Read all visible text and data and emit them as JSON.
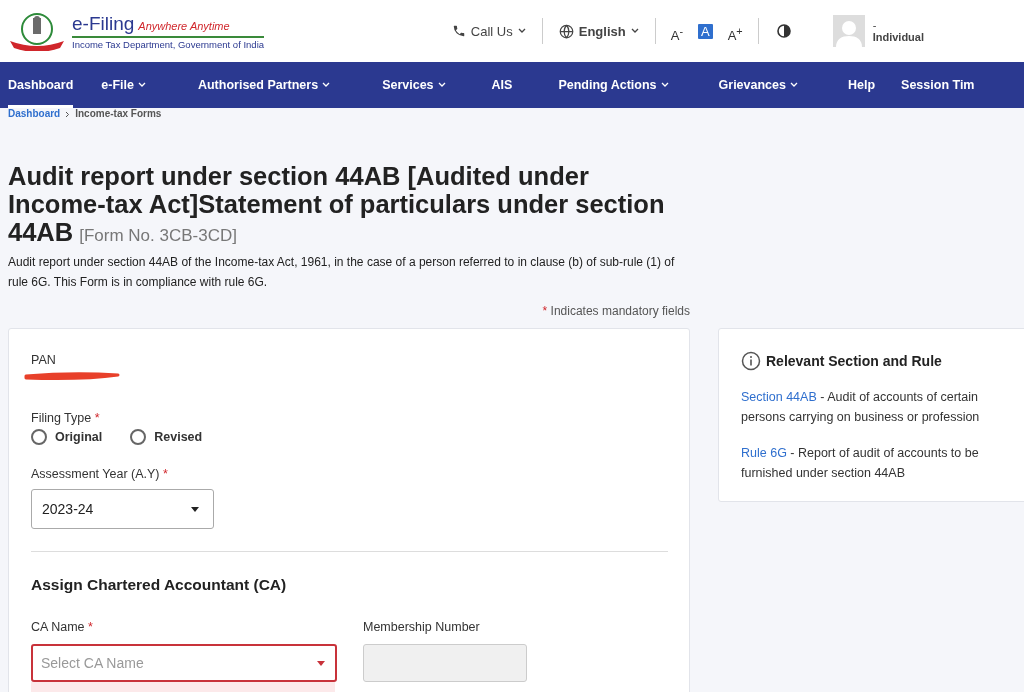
{
  "header": {
    "brand": "e-Filing",
    "tagline": "Anywhere Anytime",
    "department": "Income Tax Department, Government of India",
    "call_us": "Call Us",
    "language": "English",
    "font_sizes": [
      {
        "label": "A$^{-}$",
        "selected": false
      },
      {
        "label": "A",
        "selected": true
      },
      {
        "label": "A$^{+}$",
        "selected": false
      }
    ],
    "user": {
      "name": "-",
      "role": "Individual"
    }
  },
  "nav": [
    {
      "label": "Dashboard",
      "selected": true,
      "dropdown": false
    },
    {
      "label": "e-File",
      "selected": false,
      "dropdown": true
    },
    {
      "label": "Authorised Partners",
      "selected": false,
      "dropdown": true
    },
    {
      "label": "Services",
      "selected": false,
      "dropdown": true
    },
    {
      "label": "AIS",
      "selected": false,
      "dropdown": false
    },
    {
      "label": "Pending Actions",
      "selected": false,
      "dropdown": true
    },
    {
      "label": "Grievances",
      "selected": false,
      "dropdown": true
    },
    {
      "label": "Help",
      "selected": false,
      "dropdown": false
    },
    {
      "label": "Session Tim",
      "selected": false,
      "dropdown": false
    }
  ],
  "breadcrumb": [
    "Dashboard",
    "Income-tax Forms"
  ],
  "page": {
    "title": "Audit report under section 44AB [Audited under Income-tax Act]Statement of particulars under section 44AB",
    "form_no": "[Form No. 3CB-3CD]",
    "description": "Audit report under section 44AB of the Income-tax Act, 1961, in the case of a person referred to in clause (b) of sub-rule (1) of rule 6G. This Form is in compliance with rule 6G.",
    "mandatory_mark": "*",
    "mandatory_note": "Indicates mandatory fields"
  },
  "form": {
    "pan_label": "PAN",
    "filing_type": {
      "label": "Filing Type",
      "mark": "*",
      "options": [
        {
          "label": "Original",
          "selected": false
        },
        {
          "label": "Revised",
          "selected": false
        }
      ]
    },
    "assessment_year": {
      "label": "Assessment Year (A.Y)",
      "mark": "*",
      "value": "2023-24"
    },
    "ca_section": "Assign Chartered Accountant (CA)",
    "ca_name": {
      "label": "CA Name",
      "mark": "*",
      "placeholder": "Select CA Name",
      "error": true
    },
    "membership": {
      "label": "Membership Number",
      "disabled": true
    }
  },
  "relevant": {
    "title": "Relevant Section and Rule",
    "items": [
      {
        "link": "Section 44AB",
        "text": "- Audit of accounts of certain persons carrying on business or profession"
      },
      {
        "link": "Rule 6G",
        "text": "- Report of audit of accounts to be furnished under section 44AB"
      }
    ]
  }
}
